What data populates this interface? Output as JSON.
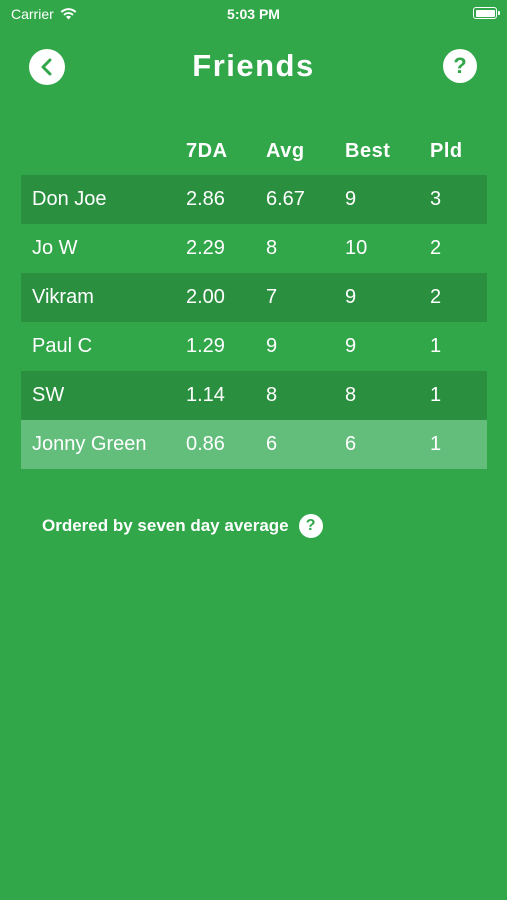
{
  "status_bar": {
    "carrier": "Carrier",
    "time": "5:03 PM",
    "wifi_icon": "wifi-icon",
    "battery_icon": "battery-icon"
  },
  "header": {
    "title": "Friends",
    "back_icon": "chevron-left-icon",
    "help_label": "?"
  },
  "table": {
    "columns": {
      "name": "",
      "seven_da": "7DA",
      "avg": "Avg",
      "best": "Best",
      "pld": "Pld"
    },
    "rows": [
      {
        "name": "Don Joe",
        "seven_da": "2.86",
        "avg": "6.67",
        "best": "9",
        "pld": "3"
      },
      {
        "name": "Jo W",
        "seven_da": "2.29",
        "avg": "8",
        "best": "10",
        "pld": "2"
      },
      {
        "name": "Vikram",
        "seven_da": "2.00",
        "avg": "7",
        "best": "9",
        "pld": "2"
      },
      {
        "name": "Paul C",
        "seven_da": "1.29",
        "avg": "9",
        "best": "9",
        "pld": "1"
      },
      {
        "name": "SW",
        "seven_da": "1.14",
        "avg": "8",
        "best": "8",
        "pld": "1"
      },
      {
        "name": "Jonny Green",
        "seven_da": "0.86",
        "avg": "6",
        "best": "6",
        "pld": "1"
      }
    ]
  },
  "note": {
    "text": "Ordered by seven day average",
    "help_label": "?"
  },
  "colors": {
    "background": "#31a74a",
    "row_dark": "#2a9040",
    "row_highlight": "#63bd7b"
  }
}
